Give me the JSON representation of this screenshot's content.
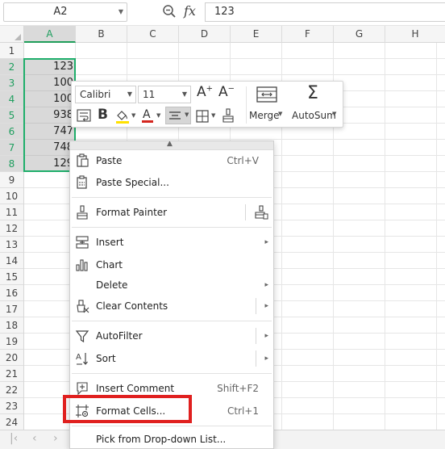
{
  "formula_bar": {
    "name_box": "A2",
    "fx": "fx",
    "formula": "123"
  },
  "grid": {
    "columns": [
      "A",
      "B",
      "C",
      "D",
      "E",
      "F",
      "G",
      "H"
    ],
    "rows": [
      "1",
      "2",
      "3",
      "4",
      "5",
      "6",
      "7",
      "8",
      "9",
      "10",
      "11",
      "12",
      "13",
      "14",
      "15",
      "16",
      "17",
      "18",
      "19",
      "20",
      "21",
      "22",
      "23",
      "24"
    ],
    "cells_a": [
      "123",
      "100",
      "100",
      "938",
      "747",
      "748",
      "129"
    ]
  },
  "mini_toolbar": {
    "font_name": "Calibri",
    "font_size": "11",
    "bold": "B",
    "merge_label": "Merge",
    "autosum_label": "AutoSum",
    "increase_font": "A",
    "decrease_font": "A",
    "font_color_letter": "A"
  },
  "context_menu": {
    "items": [
      {
        "label": "Paste",
        "shortcut": "Ctrl+V"
      },
      {
        "label": "Paste Special...",
        "shortcut": ""
      },
      {
        "label": "Format Painter",
        "shortcut": ""
      },
      {
        "label": "Insert",
        "shortcut": ""
      },
      {
        "label": "Chart",
        "shortcut": ""
      },
      {
        "label": "Delete",
        "shortcut": ""
      },
      {
        "label": "Clear Contents",
        "shortcut": ""
      },
      {
        "label": "AutoFilter",
        "shortcut": ""
      },
      {
        "label": "Sort",
        "shortcut": ""
      },
      {
        "label": "Insert Comment",
        "shortcut": "Shift+F2"
      },
      {
        "label": "Format Cells...",
        "shortcut": "Ctrl+1"
      },
      {
        "label": "Pick from Drop-down List...",
        "shortcut": ""
      }
    ]
  },
  "icons": {
    "zoom": "zoom-icon",
    "fx": "fx-icon",
    "nav_first": "first-sheet-icon",
    "nav_prev": "prev-sheet-icon",
    "nav_next": "next-sheet-icon"
  },
  "colors": {
    "selection": "#1fae6b",
    "highlight": "#e0201f",
    "font_color_bar": "#d4261f",
    "fill_color_bar": "#ffe100"
  }
}
